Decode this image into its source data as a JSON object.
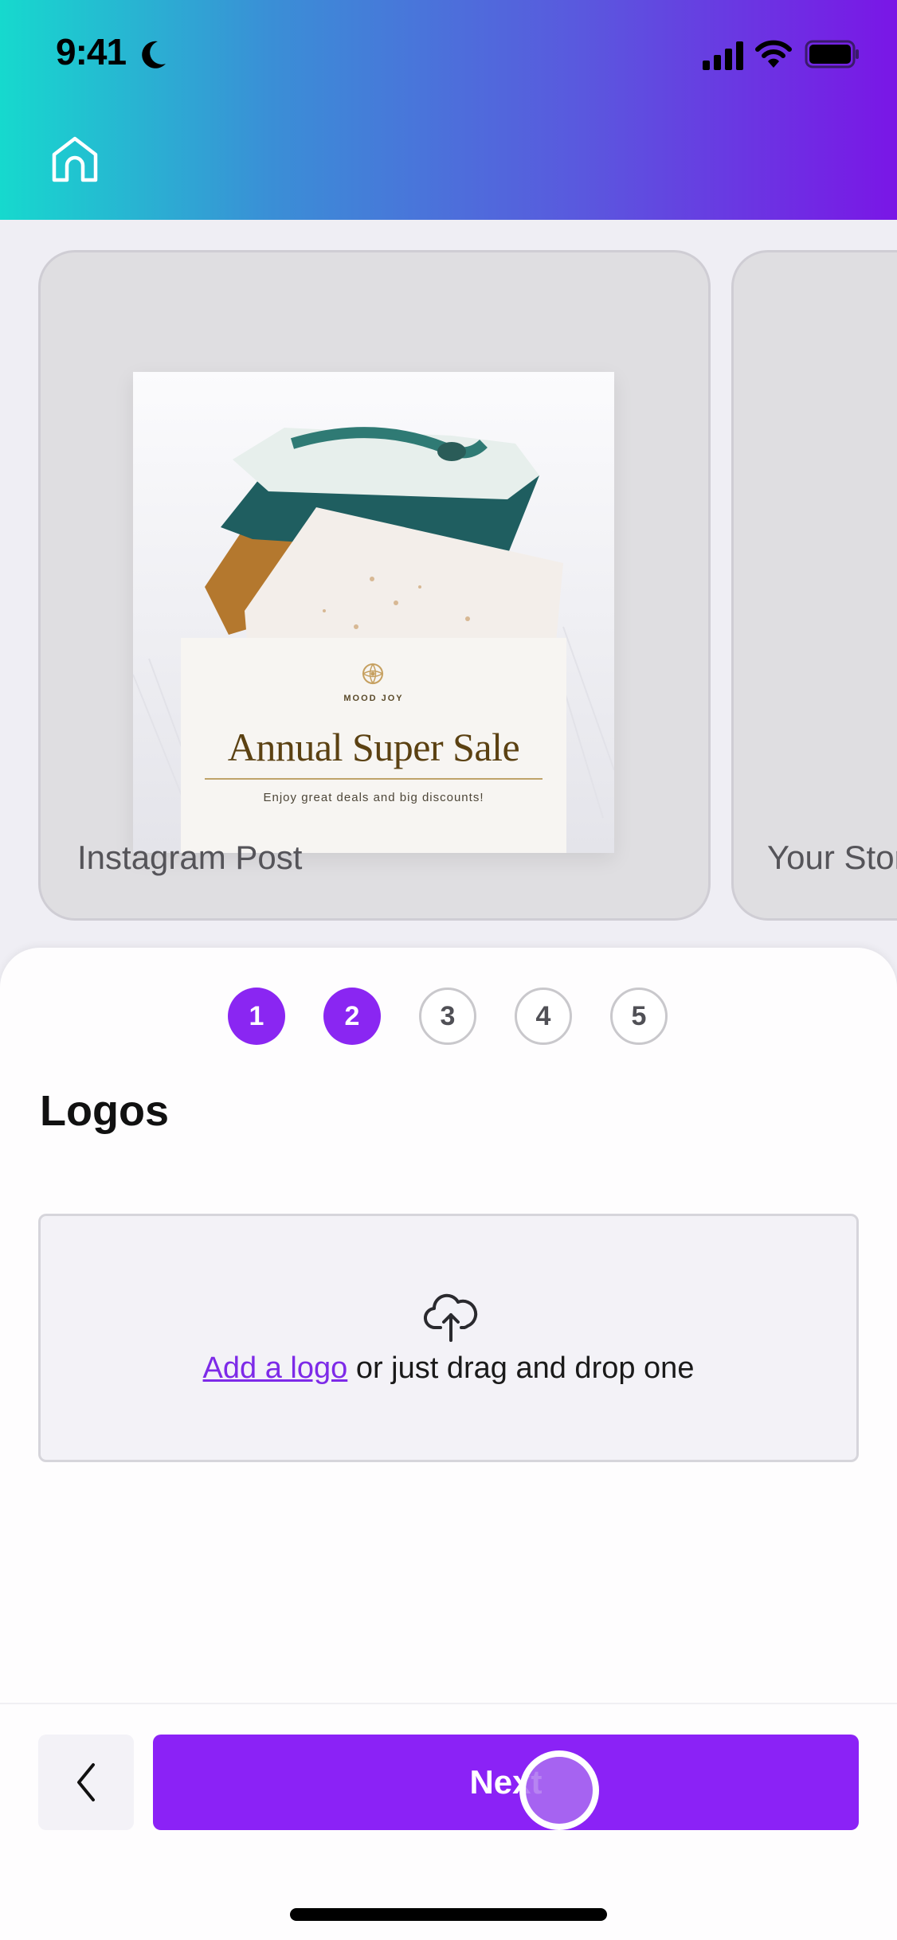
{
  "status_bar": {
    "time": "9:41",
    "icons": [
      "moon-icon",
      "signal-icon",
      "wifi-icon",
      "battery-icon"
    ]
  },
  "header": {
    "home_icon": "home-icon",
    "gradient": [
      "#16d9ce",
      "#7a16e6"
    ]
  },
  "carousel": {
    "cards": [
      {
        "label": "Instagram Post",
        "preview": {
          "brand": "MOOD JOY",
          "title": "Annual Super Sale",
          "subtitle": "Enjoy great deals and big discounts!"
        }
      },
      {
        "label": "Your Story"
      }
    ]
  },
  "wizard": {
    "steps": [
      {
        "number": "1",
        "state": "complete"
      },
      {
        "number": "2",
        "state": "current"
      },
      {
        "number": "3",
        "state": "pending"
      },
      {
        "number": "4",
        "state": "pending"
      },
      {
        "number": "5",
        "state": "pending"
      }
    ],
    "section_title": "Logos",
    "dropzone": {
      "link_text": "Add a logo",
      "rest_text": " or just drag and drop one"
    },
    "next_label": "Next"
  },
  "colors": {
    "accent": "#8b22f6",
    "link": "#7d2ae8"
  }
}
